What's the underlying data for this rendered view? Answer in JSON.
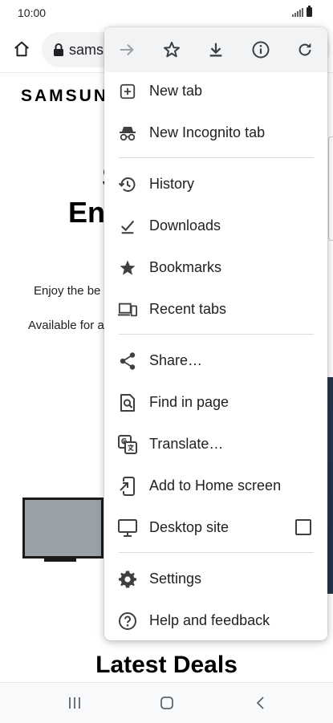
{
  "status_bar": {
    "time": "10:00"
  },
  "toolbar": {
    "url": "samsung.com"
  },
  "page": {
    "brand": "SAMSUNG",
    "hero_line1": "S",
    "hero_line2": "Ent",
    "sub1": "Enjoy the be",
    "sub2": "Available for a",
    "section_title": "Latest Deals"
  },
  "menu": {
    "top_icons": [
      "forward-icon",
      "bookmark-star-icon",
      "download-icon",
      "page-info-icon",
      "refresh-icon"
    ],
    "items": [
      {
        "label": "New tab",
        "icon": "new-tab-icon"
      },
      {
        "label": "New Incognito tab",
        "icon": "incognito-icon"
      },
      {
        "label": "History",
        "icon": "history-icon"
      },
      {
        "label": "Downloads",
        "icon": "downloads-icon"
      },
      {
        "label": "Bookmarks",
        "icon": "bookmarks-icon"
      },
      {
        "label": "Recent tabs",
        "icon": "recent-tabs-icon"
      },
      {
        "label": "Share…",
        "icon": "share-icon"
      },
      {
        "label": "Find in page",
        "icon": "find-in-page-icon"
      },
      {
        "label": "Translate…",
        "icon": "translate-icon"
      },
      {
        "label": "Add to Home screen",
        "icon": "add-to-home-icon"
      },
      {
        "label": "Desktop site",
        "icon": "desktop-icon",
        "checked": false
      },
      {
        "label": "Settings",
        "icon": "settings-icon"
      },
      {
        "label": "Help and feedback",
        "icon": "help-icon"
      }
    ]
  },
  "colors": {
    "menu_bg": "#ffffff",
    "menu_top_bg": "#f1f3f4",
    "icon": "#3c4043",
    "disabled_icon": "#9aa0a6"
  }
}
